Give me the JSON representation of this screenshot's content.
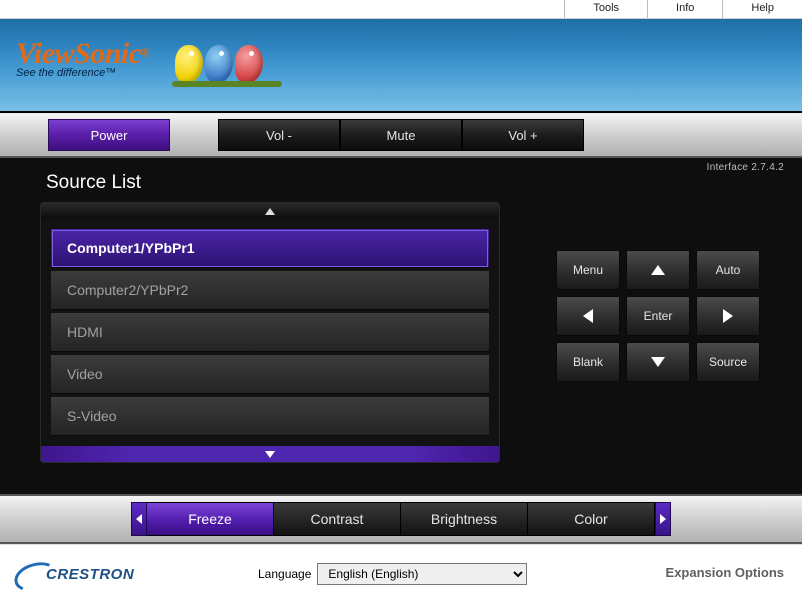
{
  "topmenu": {
    "tools": "Tools",
    "info": "Info",
    "help": "Help"
  },
  "brand": {
    "name": "ViewSonic",
    "tagline": "See the difference™"
  },
  "controlbar": {
    "power": "Power",
    "vol_down": "Vol -",
    "mute": "Mute",
    "vol_up": "Vol +"
  },
  "interface_version": "Interface 2.7.4.2",
  "source_list": {
    "title": "Source List",
    "items": [
      "Computer1/YPbPr1",
      "Computer2/YPbPr2",
      "HDMI",
      "Video",
      "S-Video"
    ]
  },
  "pad": {
    "menu": "Menu",
    "auto": "Auto",
    "enter": "Enter",
    "blank": "Blank",
    "source": "Source"
  },
  "bottom_tabs": {
    "freeze": "Freeze",
    "contrast": "Contrast",
    "brightness": "Brightness",
    "color": "Color"
  },
  "footer": {
    "crestron": "CRESTRON",
    "language_label": "Language",
    "language_value": "English (English)",
    "expansion": "Expansion Options"
  }
}
